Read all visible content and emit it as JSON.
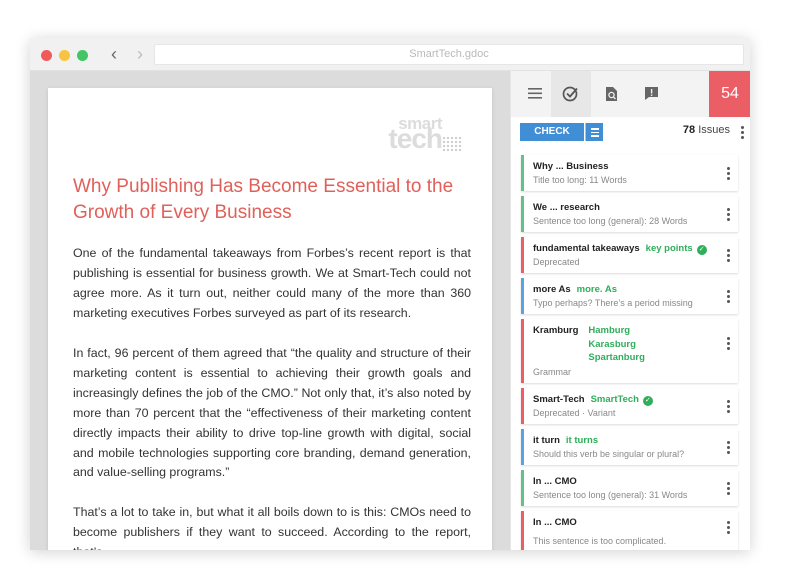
{
  "browser": {
    "url": "SmartTech.gdoc"
  },
  "document": {
    "logo_text_top": "smart",
    "logo_text_bottom": "tech",
    "title": "Why Publishing Has Become Essential to the Growth of Every Business",
    "paragraphs": [
      "One of the fundamental takeaways from Forbes’s recent report is that publishing is essential for business growth. We at Smart-Tech could not agree more. As it turn out, neither could many of the more than 360 marketing executives Forbes surveyed as part of its research.",
      "In fact, 96 percent of them agreed that “the quality and structure of their marketing content is essential to achieving their growth goals and increasingly defines the job of the CMO.” Not only that, it’s also noted by more than 70 percent that the “effectiveness of their marketing content directly impacts their ability to drive top-line growth with digital, social and mobile technologies supporting core branding, demand generation, and value-selling programs.”",
      "That’s a lot to take in, but what it all boils down to is this: CMOs need to become publishers if they want to succeed. According to the report, that’s"
    ]
  },
  "panel": {
    "score": "54",
    "check_label": "CHECK",
    "issues_count": "78",
    "issues_label": "Issues",
    "colors": {
      "green": "#62c28a",
      "red": "#ec5e66",
      "blue": "#5aa3e0",
      "accent": "#3f8ed6"
    },
    "cards": [
      {
        "title": "Why ... Business",
        "desc": "Title too long: 11 Words"
      },
      {
        "title": "We ... research",
        "desc": "Sentence too long (general): 28 Words"
      },
      {
        "title": "fundamental takeaways",
        "suggestion": "key points",
        "desc": "Deprecated"
      },
      {
        "title": "more As",
        "suggestion": "more. As",
        "desc": "Typo perhaps? There’s a period missing"
      },
      {
        "title": "Kramburg",
        "suggestions": [
          "Hamburg",
          "Karasburg",
          "Spartanburg"
        ],
        "desc": "Grammar"
      },
      {
        "title": "Smart-Tech",
        "suggestion": "SmartTech",
        "desc": "Deprecated · Variant"
      },
      {
        "title": "it turn",
        "suggestion": "it turns",
        "desc": "Should this verb be singular or plural?"
      },
      {
        "title": "In ... CMO",
        "desc": "Sentence too long (general): 31 Words"
      },
      {
        "title": "In ... CMO",
        "desc": "This sentence is too complicated."
      }
    ]
  }
}
